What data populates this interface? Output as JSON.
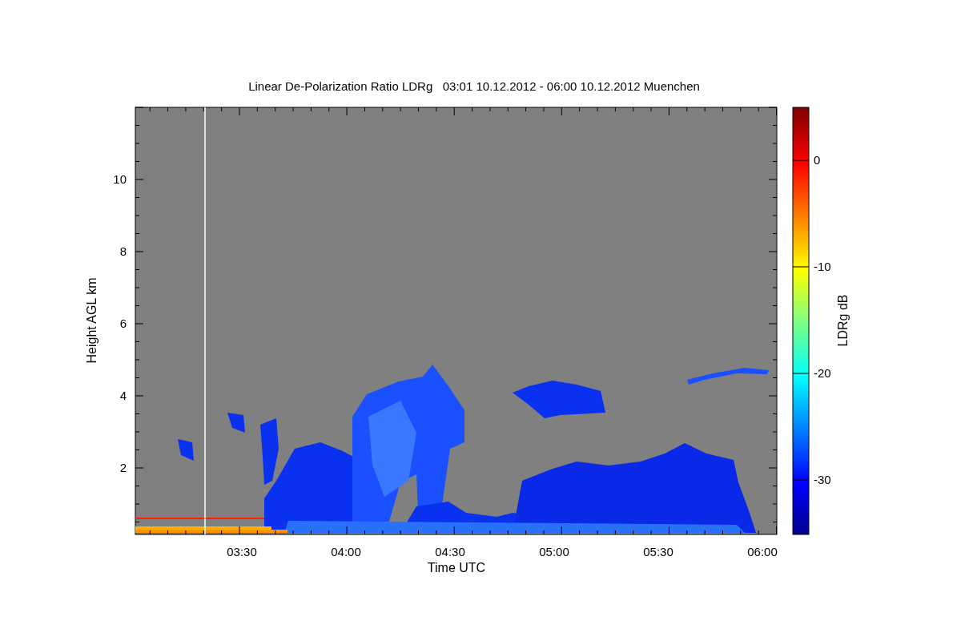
{
  "title": "Linear De-Polarization Ratio LDRg   03:01 10.12.2012 - 06:00 10.12.2012 Muenchen",
  "plot": {
    "xlabel": "Time UTC",
    "ylabel": "Height AGL km",
    "xticks": [
      "03:30",
      "04:00",
      "04:30",
      "05:00",
      "05:30",
      "06:00"
    ],
    "yticks": [
      "10",
      "8",
      "6",
      "4",
      "2"
    ]
  },
  "colorbar": {
    "label": "LDRg dB",
    "ticks": [
      "0",
      "-10",
      "-20",
      "-30"
    ]
  }
}
